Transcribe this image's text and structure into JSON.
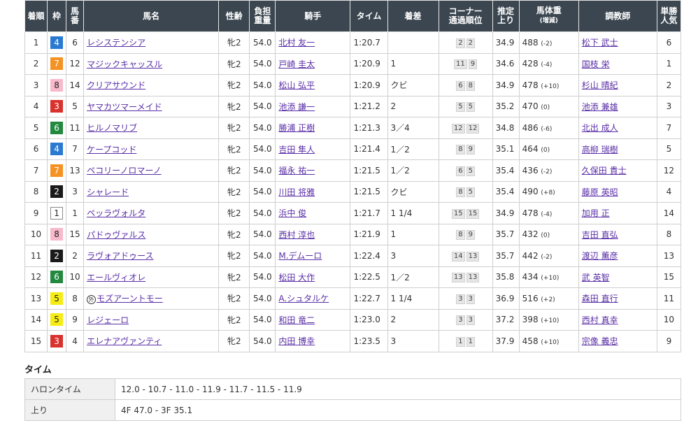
{
  "headers": {
    "rank": "着順",
    "waku": "枠",
    "umaban": [
      "馬",
      "番"
    ],
    "horse": "馬名",
    "sexage": "性齢",
    "weight": [
      "負担",
      "重量"
    ],
    "jockey": "騎手",
    "time": "タイム",
    "margin": "着差",
    "corner": [
      "コーナー",
      "通過順位"
    ],
    "last3f": [
      "推定",
      "上り"
    ],
    "bodyweight": [
      "馬体重",
      "(増減)"
    ],
    "trainer": "調教師",
    "pop": [
      "単勝",
      "人気"
    ]
  },
  "waku_colors": {
    "1": "#ffffff",
    "2": "#1a1a1a",
    "3": "#d9322d",
    "4": "#2a7ad1",
    "5": "#f5ec15",
    "6": "#22893f",
    "7": "#f49224",
    "8": "#f7b9cb"
  },
  "link_color": "#5a2ea6",
  "header_bg": "#3b4650",
  "rows": [
    {
      "rank": "1",
      "waku": "4",
      "umaban": "6",
      "horse": "レシステンシア",
      "gai": "",
      "sexage": "牝2",
      "weight": "54.0",
      "jockey": "北村 友一",
      "time": "1:20.7",
      "margin": "",
      "corner": [
        "2",
        "2"
      ],
      "last3f": "34.9",
      "bw": "488",
      "bwd": "(-2)",
      "trainer": "松下 武士",
      "pop": "6"
    },
    {
      "rank": "2",
      "waku": "7",
      "umaban": "12",
      "horse": "マジックキャッスル",
      "gai": "",
      "sexage": "牝2",
      "weight": "54.0",
      "jockey": "戸崎 圭太",
      "time": "1:20.9",
      "margin": "1",
      "corner": [
        "11",
        "9"
      ],
      "last3f": "34.6",
      "bw": "428",
      "bwd": "(-4)",
      "trainer": "国枝 栄",
      "pop": "1"
    },
    {
      "rank": "3",
      "waku": "8",
      "umaban": "14",
      "horse": "クリアサウンド",
      "gai": "",
      "sexage": "牝2",
      "weight": "54.0",
      "jockey": "松山 弘平",
      "time": "1:20.9",
      "margin": "クビ",
      "corner": [
        "6",
        "8"
      ],
      "last3f": "34.9",
      "bw": "478",
      "bwd": "(+10)",
      "trainer": "杉山 晴紀",
      "pop": "2"
    },
    {
      "rank": "4",
      "waku": "3",
      "umaban": "5",
      "horse": "ヤマカツマーメイド",
      "gai": "",
      "sexage": "牝2",
      "weight": "54.0",
      "jockey": "池添 謙一",
      "time": "1:21.2",
      "margin": "2",
      "corner": [
        "5",
        "5"
      ],
      "last3f": "35.2",
      "bw": "470",
      "bwd": "(0)",
      "trainer": "池添 兼雄",
      "pop": "3"
    },
    {
      "rank": "5",
      "waku": "6",
      "umaban": "11",
      "horse": "ヒルノマリブ",
      "gai": "",
      "sexage": "牝2",
      "weight": "54.0",
      "jockey": "勝浦 正樹",
      "time": "1:21.3",
      "margin": "3／4",
      "corner": [
        "12",
        "12"
      ],
      "last3f": "34.8",
      "bw": "486",
      "bwd": "(-6)",
      "trainer": "北出 成人",
      "pop": "7"
    },
    {
      "rank": "6",
      "waku": "4",
      "umaban": "7",
      "horse": "ケープコッド",
      "gai": "",
      "sexage": "牝2",
      "weight": "54.0",
      "jockey": "吉田 隼人",
      "time": "1:21.4",
      "margin": "1／2",
      "corner": [
        "8",
        "9"
      ],
      "last3f": "35.1",
      "bw": "464",
      "bwd": "(0)",
      "trainer": "高柳 瑞樹",
      "pop": "5"
    },
    {
      "rank": "7",
      "waku": "7",
      "umaban": "13",
      "horse": "ペコリーノロマーノ",
      "gai": "",
      "sexage": "牝2",
      "weight": "54.0",
      "jockey": "福永 祐一",
      "time": "1:21.5",
      "margin": "1／2",
      "corner": [
        "6",
        "5"
      ],
      "last3f": "35.4",
      "bw": "436",
      "bwd": "(-2)",
      "trainer": "久保田 貴士",
      "pop": "12"
    },
    {
      "rank": "8",
      "waku": "2",
      "umaban": "3",
      "horse": "シャレード",
      "gai": "",
      "sexage": "牝2",
      "weight": "54.0",
      "jockey": "川田 将雅",
      "time": "1:21.5",
      "margin": "クビ",
      "corner": [
        "8",
        "5"
      ],
      "last3f": "35.4",
      "bw": "490",
      "bwd": "(+8)",
      "trainer": "藤原 英昭",
      "pop": "4"
    },
    {
      "rank": "9",
      "waku": "1",
      "umaban": "1",
      "horse": "ペッラヴォルタ",
      "gai": "",
      "sexage": "牝2",
      "weight": "54.0",
      "jockey": "浜中 俊",
      "time": "1:21.7",
      "margin": "1 1/4",
      "corner": [
        "15",
        "15"
      ],
      "last3f": "34.9",
      "bw": "478",
      "bwd": "(-4)",
      "trainer": "加用 正",
      "pop": "14"
    },
    {
      "rank": "10",
      "waku": "8",
      "umaban": "15",
      "horse": "パドゥヴァルス",
      "gai": "",
      "sexage": "牝2",
      "weight": "54.0",
      "jockey": "西村 淳也",
      "time": "1:21.9",
      "margin": "1",
      "corner": [
        "8",
        "9"
      ],
      "last3f": "35.7",
      "bw": "432",
      "bwd": "(0)",
      "trainer": "吉田 直弘",
      "pop": "8"
    },
    {
      "rank": "11",
      "waku": "2",
      "umaban": "2",
      "horse": "ラヴォアドゥース",
      "gai": "",
      "sexage": "牝2",
      "weight": "54.0",
      "jockey": "M.デムーロ",
      "time": "1:22.4",
      "margin": "3",
      "corner": [
        "14",
        "13"
      ],
      "last3f": "35.7",
      "bw": "442",
      "bwd": "(-2)",
      "trainer": "渡辺 薫彦",
      "pop": "13"
    },
    {
      "rank": "12",
      "waku": "6",
      "umaban": "10",
      "horse": "エールヴィオレ",
      "gai": "",
      "sexage": "牝2",
      "weight": "54.0",
      "jockey": "松田 大作",
      "time": "1:22.5",
      "margin": "1／2",
      "corner": [
        "13",
        "13"
      ],
      "last3f": "35.8",
      "bw": "434",
      "bwd": "(+10)",
      "trainer": "武 英智",
      "pop": "15"
    },
    {
      "rank": "13",
      "waku": "5",
      "umaban": "8",
      "horse": "モズアーントモー",
      "gai": "外",
      "sexage": "牝2",
      "weight": "54.0",
      "jockey": "A.シュタルケ",
      "time": "1:22.7",
      "margin": "1 1/4",
      "corner": [
        "3",
        "3"
      ],
      "last3f": "36.9",
      "bw": "516",
      "bwd": "(+2)",
      "trainer": "森田 直行",
      "pop": "11"
    },
    {
      "rank": "14",
      "waku": "5",
      "umaban": "9",
      "horse": "レジェーロ",
      "gai": "",
      "sexage": "牝2",
      "weight": "54.0",
      "jockey": "和田 竜二",
      "time": "1:23.0",
      "margin": "2",
      "corner": [
        "3",
        "3"
      ],
      "last3f": "37.2",
      "bw": "398",
      "bwd": "(+10)",
      "trainer": "西村 真幸",
      "pop": "10"
    },
    {
      "rank": "15",
      "waku": "3",
      "umaban": "4",
      "horse": "エレナアヴァンティ",
      "gai": "",
      "sexage": "牝2",
      "weight": "54.0",
      "jockey": "内田 博幸",
      "time": "1:23.5",
      "margin": "3",
      "corner": [
        "1",
        "1"
      ],
      "last3f": "37.9",
      "bw": "458",
      "bwd": "(+10)",
      "trainer": "宗像 義忠",
      "pop": "9"
    }
  ],
  "time_section": {
    "heading": "タイム",
    "halon_label": "ハロンタイム",
    "halon_value": "12.0 - 10.7 - 11.0 - 11.9 - 11.7 - 11.5 - 11.9",
    "agari_label": "上り",
    "agari_value": "4F 47.0 - 3F 35.1"
  }
}
